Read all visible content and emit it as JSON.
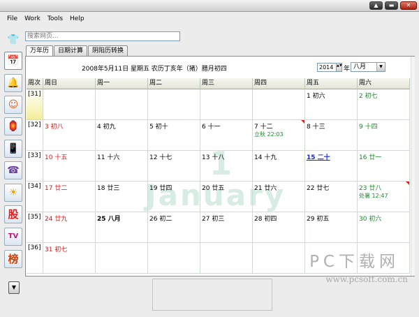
{
  "menu": [
    "File",
    "Work",
    "Tools",
    "Help"
  ],
  "window_buttons": [
    "▲",
    "▬",
    "✕"
  ],
  "search": {
    "placeholder": "搜索网页..."
  },
  "tabs": [
    {
      "label": "万年历",
      "active": true
    },
    {
      "label": "日期计算",
      "active": false
    },
    {
      "label": "阴阳历转换",
      "active": false
    }
  ],
  "sidebar": {
    "icons": [
      "shirt-icon",
      "calendar-icon",
      "bell-icon",
      "avatar-icon",
      "lantern-icon",
      "phone-icon",
      "contacts-icon",
      "weather-icon",
      "stock-icon",
      "tv-icon",
      "ranking-icon"
    ],
    "glyphs": [
      "👕",
      "📅",
      "🔔",
      "☺",
      "🏮",
      "📱",
      "☎",
      "☀",
      "股",
      "TV",
      "榜"
    ],
    "dropdown": "▼"
  },
  "header": {
    "date_text": "2008年5月11日 星期五 农历丁亥年（猪）腊月初四",
    "year": "2014",
    "year_label": "年",
    "month": "八月",
    "spin": "▲▼",
    "dropdown_arrow": "▼"
  },
  "calendar": {
    "headers": [
      "周次",
      "周日",
      "周一",
      "周二",
      "周三",
      "周四",
      "周五",
      "周六"
    ],
    "weeks": [
      {
        "week": "[31]",
        "days": [
          null,
          null,
          null,
          null,
          null,
          {
            "n": "1",
            "l": "初六"
          },
          {
            "n": "2",
            "l": "初七",
            "c": "green"
          }
        ]
      },
      {
        "week": "[32]",
        "days": [
          {
            "n": "3",
            "l": "初八",
            "c": "red"
          },
          {
            "n": "4",
            "l": "初九"
          },
          {
            "n": "5",
            "l": "初十"
          },
          {
            "n": "6",
            "l": "十一"
          },
          {
            "n": "7",
            "l": "十二",
            "term": "立秋 22:03",
            "flag": true
          },
          {
            "n": "8",
            "l": "十三"
          },
          {
            "n": "9",
            "l": "十四",
            "c": "green"
          }
        ]
      },
      {
        "week": "[33]",
        "days": [
          {
            "n": "10",
            "l": "十五",
            "c": "red"
          },
          {
            "n": "11",
            "l": "十六"
          },
          {
            "n": "12",
            "l": "十七"
          },
          {
            "n": "13",
            "l": "十八"
          },
          {
            "n": "14",
            "l": "十九"
          },
          {
            "n": "15",
            "l": "二十",
            "c": "blue"
          },
          {
            "n": "16",
            "l": "廿一",
            "c": "green"
          }
        ]
      },
      {
        "week": "[34]",
        "days": [
          {
            "n": "17",
            "l": "廿二",
            "c": "red"
          },
          {
            "n": "18",
            "l": "廿三"
          },
          {
            "n": "19",
            "l": "廿四"
          },
          {
            "n": "20",
            "l": "廿五"
          },
          {
            "n": "21",
            "l": "廿六"
          },
          {
            "n": "22",
            "l": "廿七"
          },
          {
            "n": "23",
            "l": "廿八",
            "c": "green",
            "term": "处暑 12:47",
            "flag": true
          }
        ]
      },
      {
        "week": "[35]",
        "days": [
          {
            "n": "24",
            "l": "廿九",
            "c": "red"
          },
          {
            "n": "25",
            "l": "八月",
            "c": "bold"
          },
          {
            "n": "26",
            "l": "初二"
          },
          {
            "n": "27",
            "l": "初三"
          },
          {
            "n": "28",
            "l": "初四"
          },
          {
            "n": "29",
            "l": "初五"
          },
          {
            "n": "30",
            "l": "初六",
            "c": "green"
          }
        ]
      },
      {
        "week": "[36]",
        "days": [
          {
            "n": "31",
            "l": "初七",
            "c": "red"
          },
          null,
          null,
          null,
          null,
          null,
          null
        ]
      }
    ]
  },
  "watermark": {
    "number": "1",
    "word": "January"
  },
  "site": {
    "logo": "PC下载网",
    "url": "www.pcsoft.com.cn"
  }
}
